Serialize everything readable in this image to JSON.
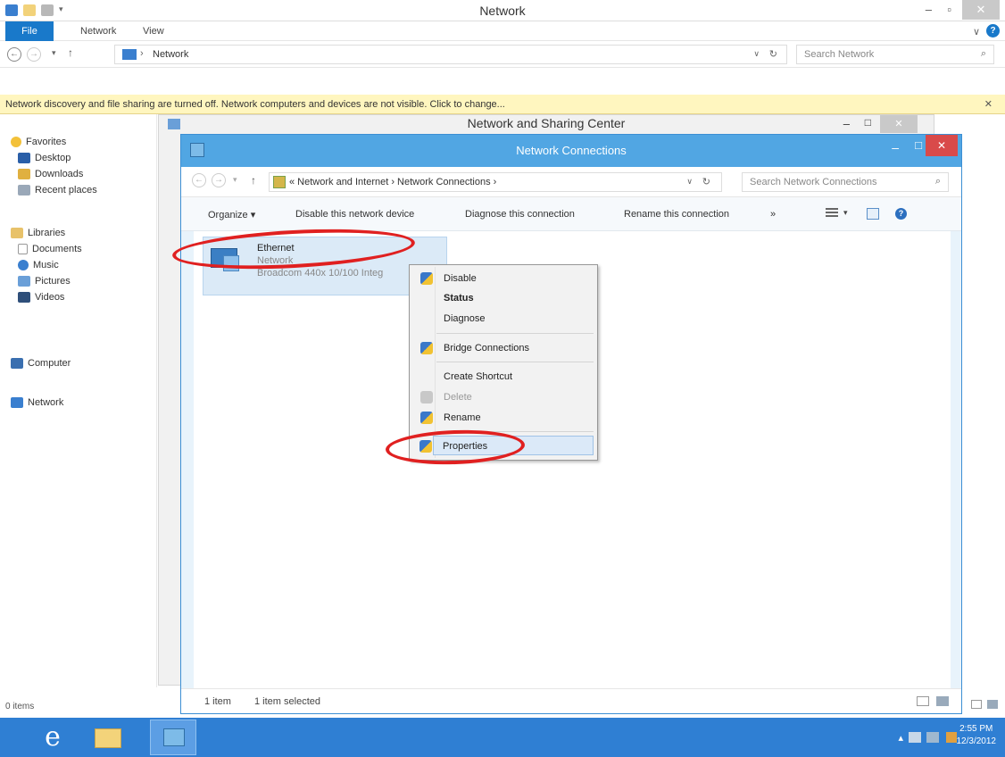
{
  "outer_window": {
    "title": "Network",
    "ribbon_tabs": [
      "File",
      "Network",
      "View"
    ],
    "breadcrumb": "Network",
    "search_placeholder": "Search Network",
    "info_bar": "Network discovery and file sharing are turned off. Network computers and devices are not visible. Click to change...",
    "status": "0 items"
  },
  "sidebar": {
    "favorites_label": "Favorites",
    "favorites": [
      "Desktop",
      "Downloads",
      "Recent places"
    ],
    "libraries_label": "Libraries",
    "libraries": [
      "Documents",
      "Music",
      "Pictures",
      "Videos"
    ],
    "computer_label": "Computer",
    "network_label": "Network"
  },
  "sharing_center": {
    "title": "Network and Sharing Center"
  },
  "connections_window": {
    "title": "Network Connections",
    "breadcrumb": "« Network and Internet ›  Network Connections ›",
    "search_placeholder": "Search Network Connections",
    "toolbar": {
      "organize": "Organize ▾",
      "disable": "Disable this network device",
      "diagnose": "Diagnose this connection",
      "rename": "Rename this connection",
      "more": "»"
    },
    "adapter": {
      "name": "Ethernet",
      "network": "Network",
      "description": "Broadcom 440x 10/100 Integ"
    },
    "status": {
      "count": "1 item",
      "selected": "1 item selected"
    }
  },
  "context_menu": {
    "items": [
      {
        "label": "Disable",
        "shield": true
      },
      {
        "label": "Status",
        "bold": true
      },
      {
        "label": "Diagnose"
      },
      {
        "label": "Bridge Connections",
        "shield": true
      },
      {
        "label": "Create Shortcut"
      },
      {
        "label": "Delete",
        "disabled": true
      },
      {
        "label": "Rename",
        "shield": true
      },
      {
        "label": "Properties",
        "shield": true,
        "selected": true
      }
    ]
  },
  "taskbar": {
    "ie_glyph": "e",
    "time": "2:55 PM",
    "date": "12/3/2012"
  },
  "colors": {
    "annotation": "#e02020",
    "accent": "#51a6e3",
    "taskbar": "#2f7fd3"
  }
}
